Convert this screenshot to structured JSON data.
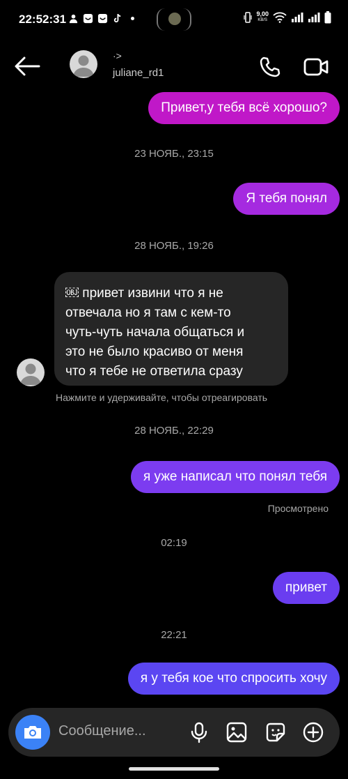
{
  "status_bar": {
    "time": "22:52:31",
    "speed_value": "9,00",
    "speed_unit": "KB/S",
    "battery": "full"
  },
  "header": {
    "name_top": "·>",
    "username": "juliane_rd1",
    "back_icon": "arrow-left-icon",
    "call_icon": "phone-icon",
    "video_icon": "video-camera-icon"
  },
  "messages": [
    {
      "type": "outgoing",
      "text": "Привет,у тебя всё хорошо?",
      "color": "#c018c8"
    },
    {
      "type": "timestamp",
      "text": "23 НОЯБ., 23:15"
    },
    {
      "type": "outgoing",
      "text": "Я тебя понял",
      "color": "#a52ae0"
    },
    {
      "type": "timestamp",
      "text": "28 НОЯБ., 19:26"
    },
    {
      "type": "incoming",
      "lines": [
        "￼ привет извини что я не",
        "отвечала но я там с кем-то",
        "чуть-чуть начала общаться и",
        "это не было красиво от меня",
        "что я тебе не ответила сразу"
      ],
      "hint": "Нажмите и удерживайте, чтобы отреагировать"
    },
    {
      "type": "timestamp",
      "text": "28 НОЯБ., 22:29"
    },
    {
      "type": "outgoing",
      "text": "я уже написал что понял тебя",
      "color": "#7c3cf0",
      "status": "Просмотрено"
    },
    {
      "type": "timestamp",
      "text": "02:19"
    },
    {
      "type": "outgoing",
      "text": "привет",
      "color": "#6a3df0"
    },
    {
      "type": "timestamp",
      "text": "22:21"
    },
    {
      "type": "outgoing",
      "text": "я у тебя кое что спросить хочу",
      "color": "#5b46f2"
    }
  ],
  "composer": {
    "placeholder": "Сообщение...",
    "camera_icon": "camera-icon",
    "mic_icon": "microphone-icon",
    "gallery_icon": "image-icon",
    "sticker_icon": "sticker-icon",
    "plus_icon": "plus-circle-icon",
    "accent": "#3b82f6"
  }
}
